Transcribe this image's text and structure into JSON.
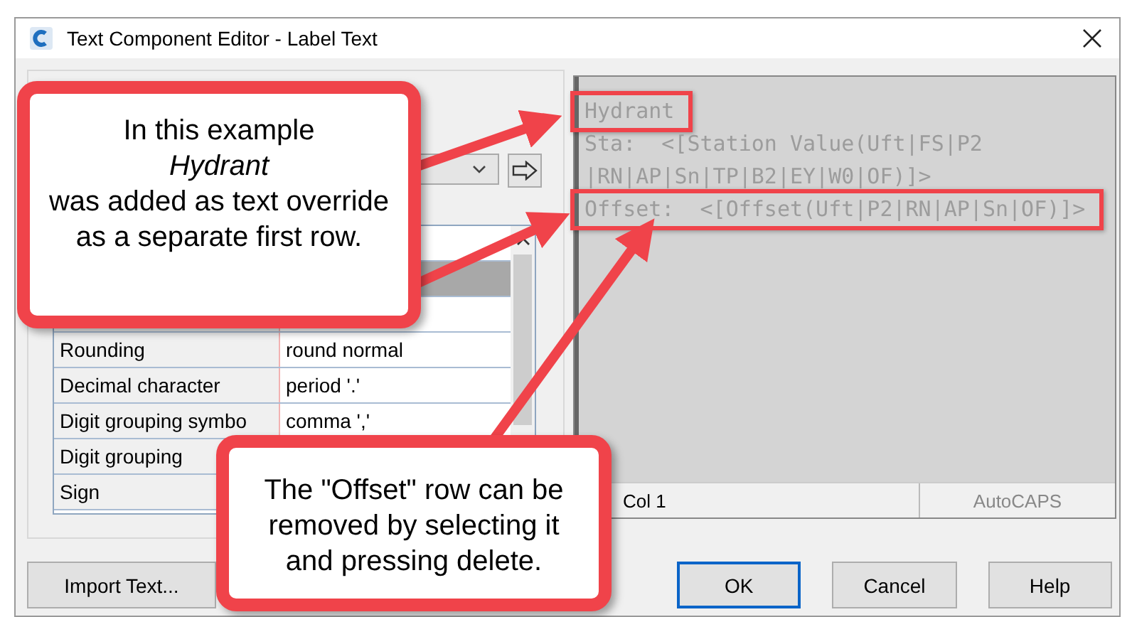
{
  "window": {
    "title": "Text Component Editor - Label Text"
  },
  "properties": {
    "rows": [
      {
        "selected": false
      },
      {
        "selected": true
      },
      {
        "selected": false
      },
      {
        "name": "Rounding",
        "value": "round normal",
        "selected": false
      },
      {
        "name": "Decimal character",
        "value": "period '.'",
        "selected": false
      },
      {
        "name": "Digit grouping symbo",
        "value": "comma ','",
        "selected": false
      },
      {
        "name": "Digit grouping",
        "selected": false
      },
      {
        "name": "Sign",
        "selected": false
      }
    ]
  },
  "editor": {
    "lines": [
      {
        "text": "Hydrant",
        "highlighted": true
      },
      {
        "text": "Sta:  <[Station Value(Uft|FS|P2",
        "highlighted": false
      },
      {
        "text": "|RN|AP|Sn|TP|B2|EY|W0|OF)]>",
        "highlighted": false
      },
      {
        "text": "Offset:  <[Offset(Uft|P2|RN|AP|Sn|OF)]>",
        "highlighted": true
      }
    ]
  },
  "status_bar": [
    "Col 1",
    "AutoCAPS"
  ],
  "buttons": [
    {
      "label": "Import Text...",
      "default": false
    },
    {
      "label": "OK",
      "default": true
    },
    {
      "label": "Cancel",
      "default": false
    },
    {
      "label": "Help",
      "default": false
    }
  ],
  "callouts": [
    {
      "text": "In this example\n*Hydrant*\nwas added as text override as a separate first row."
    },
    {
      "text": "The \"Offset\" row can be removed by selecting it and pressing delete."
    }
  ]
}
